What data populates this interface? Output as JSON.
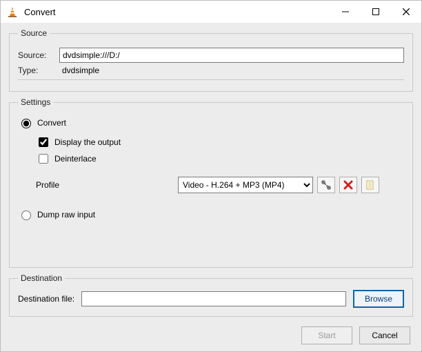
{
  "window": {
    "title": "Convert"
  },
  "source": {
    "legend": "Source",
    "source_label": "Source:",
    "source_value": "dvdsimple:///D:/",
    "type_label": "Type:",
    "type_value": "dvdsimple"
  },
  "settings": {
    "legend": "Settings",
    "convert_label": "Convert",
    "display_output_label": "Display the output",
    "deinterlace_label": "Deinterlace",
    "profile_label": "Profile",
    "profile_selected": "Video - H.264 + MP3 (MP4)",
    "dump_raw_label": "Dump raw input"
  },
  "destination": {
    "legend": "Destination",
    "file_label": "Destination file:",
    "file_value": "",
    "browse_label": "Browse"
  },
  "footer": {
    "start_label": "Start",
    "cancel_label": "Cancel"
  }
}
